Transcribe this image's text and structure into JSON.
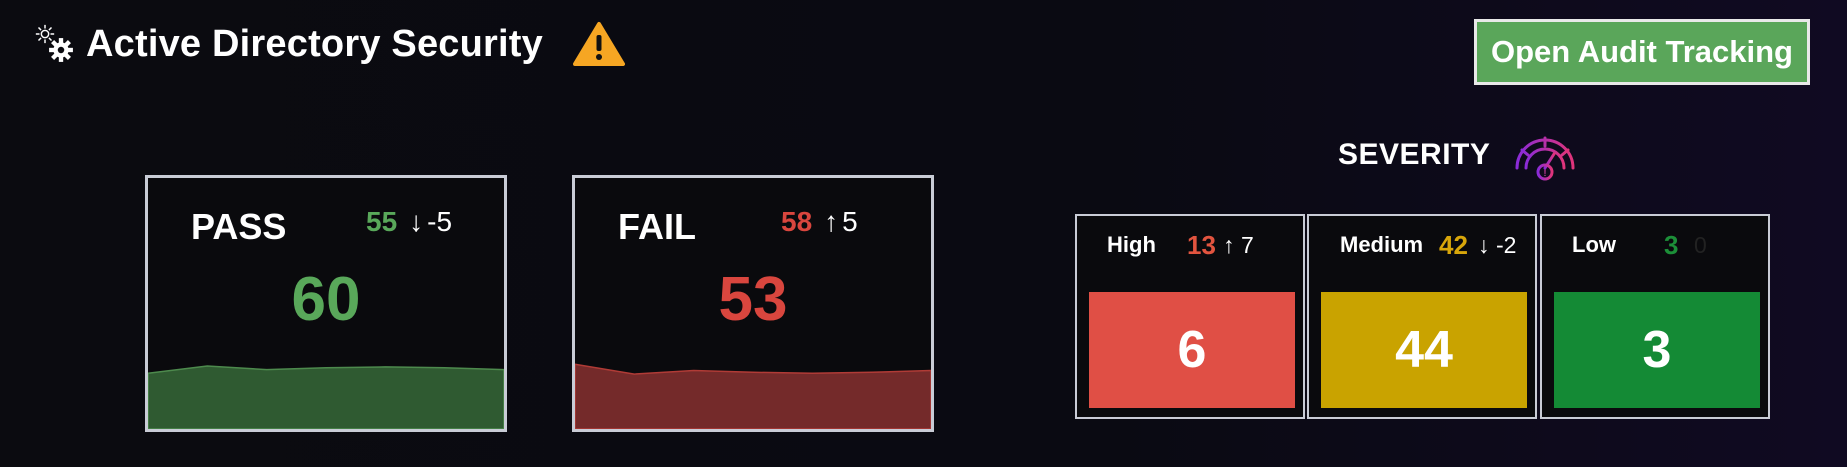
{
  "header": {
    "title": "Active Directory Security",
    "icon": "gear-icon",
    "warning_icon": "warning-icon",
    "audit_button_label": "Open Audit Tracking"
  },
  "pass": {
    "label": "PASS",
    "value": "60",
    "previous": "55",
    "change_arrow": "↓",
    "change": "-5",
    "color": "#59a85a",
    "series": [
      62,
      70,
      66,
      68,
      69,
      68,
      66
    ]
  },
  "fail": {
    "label": "FAIL",
    "value": "53",
    "previous": "58",
    "change_arrow": "↑",
    "change": "5",
    "color": "#d9463e",
    "series": [
      72,
      61,
      65,
      63,
      62,
      63,
      65
    ]
  },
  "severity": {
    "title": "SEVERITY",
    "icon": "gauge-icon",
    "levels": [
      {
        "label": "High",
        "previous": "13",
        "change_arrow": "↑",
        "change": "7",
        "value": "6",
        "prev_color": "#e2543f",
        "block_color": "#e04f45"
      },
      {
        "label": "Medium",
        "previous": "42",
        "change_arrow": "↓",
        "change": "-2",
        "value": "44",
        "prev_color": "#d8a60a",
        "block_color": "#c9a300"
      },
      {
        "label": "Low",
        "previous": "3",
        "change_arrow": "",
        "change": "0",
        "value": "3",
        "prev_color": "#1c8f38",
        "block_color": "#148a35"
      }
    ]
  },
  "colors": {
    "accent_green": "#5aa65a",
    "pass_fill": "#2f5a31",
    "fail_fill": "#742a2a",
    "warning": "#f6a623"
  }
}
